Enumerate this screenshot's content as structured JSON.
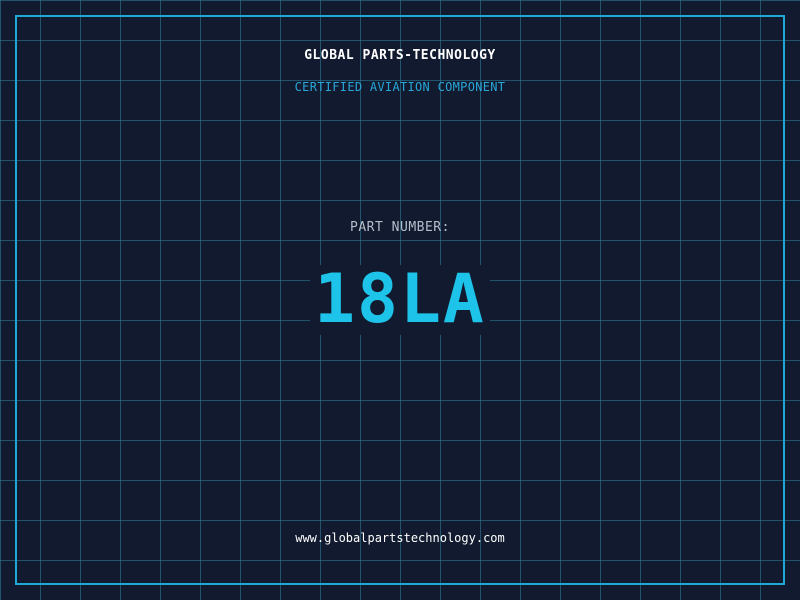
{
  "header": {
    "company": "GLOBAL PARTS-TECHNOLOGY",
    "tagline": "CERTIFIED AVIATION COMPONENT"
  },
  "part": {
    "label": "PART NUMBER:",
    "number": "18LA"
  },
  "footer": {
    "url": "www.globalpartstechnology.com"
  },
  "colors": {
    "background": "#111a2e",
    "grid": "#3082a0",
    "frame": "#1ea8d4",
    "accent": "#1ec3ea",
    "tagline": "#29a6d8",
    "label": "#b5bfcc",
    "text": "#ffffff"
  }
}
